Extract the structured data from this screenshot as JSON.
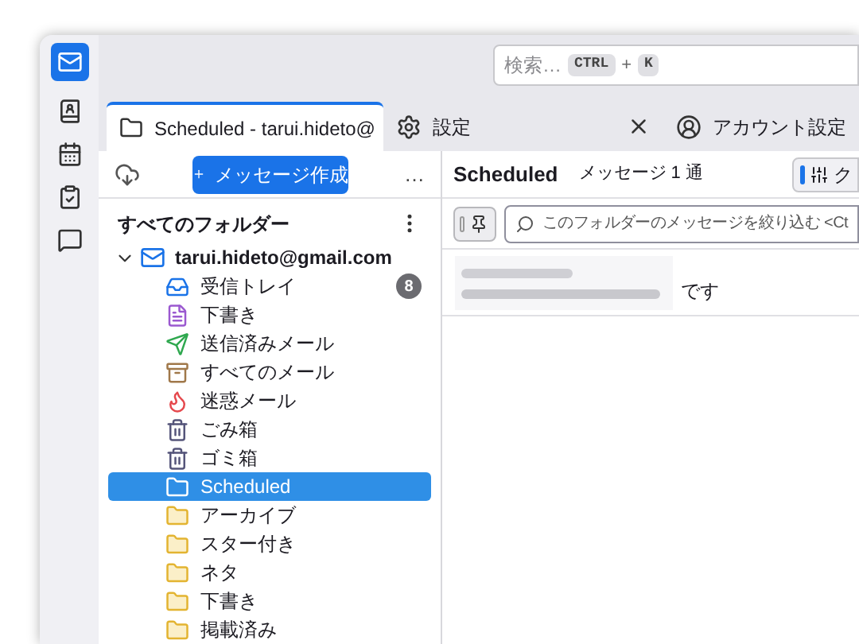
{
  "search": {
    "placeholder": "検索…",
    "keys": [
      "CTRL",
      "+",
      "K"
    ]
  },
  "tabs": [
    {
      "kind": "folder",
      "label": "Scheduled - tarui.hideto@",
      "selected": true,
      "closable": false
    },
    {
      "kind": "settings",
      "label": "設定",
      "selected": false,
      "closable": true
    },
    {
      "kind": "account",
      "label": "アカウント設定",
      "selected": false,
      "closable": false
    }
  ],
  "folder_pane": {
    "compose_button": "メッセージ作成",
    "more": "…",
    "header": "すべてのフォルダー",
    "account": {
      "name": "tarui.hideto@gmail.com",
      "expanded": true,
      "folders": [
        {
          "kind": "inbox",
          "name": "受信トレイ",
          "badge": "8",
          "selected": false
        },
        {
          "kind": "drafts",
          "name": "下書き",
          "selected": false
        },
        {
          "kind": "sent",
          "name": "送信済みメール",
          "selected": false
        },
        {
          "kind": "archive",
          "name": "すべてのメール",
          "selected": false
        },
        {
          "kind": "junk",
          "name": "迷惑メール",
          "selected": false
        },
        {
          "kind": "trash",
          "name": "ごみ箱",
          "selected": false
        },
        {
          "kind": "trash",
          "name": "ゴミ箱",
          "selected": false
        },
        {
          "kind": "folder",
          "name": "Scheduled",
          "selected": true
        },
        {
          "kind": "folder",
          "name": "アーカイブ",
          "selected": false
        },
        {
          "kind": "folder",
          "name": "スター付き",
          "selected": false
        },
        {
          "kind": "folder",
          "name": "ネタ",
          "selected": false
        },
        {
          "kind": "folder",
          "name": "下書き",
          "selected": false
        },
        {
          "kind": "folder",
          "name": "掲載済み",
          "selected": false
        }
      ]
    }
  },
  "message_pane": {
    "title": "Scheduled",
    "count": "メッセージ 1 通",
    "quick_filter": "ク",
    "filter_placeholder": "このフォルダーのメッセージを絞り込む <Ct",
    "messages": [
      {
        "subject_tail": "です"
      }
    ]
  }
}
